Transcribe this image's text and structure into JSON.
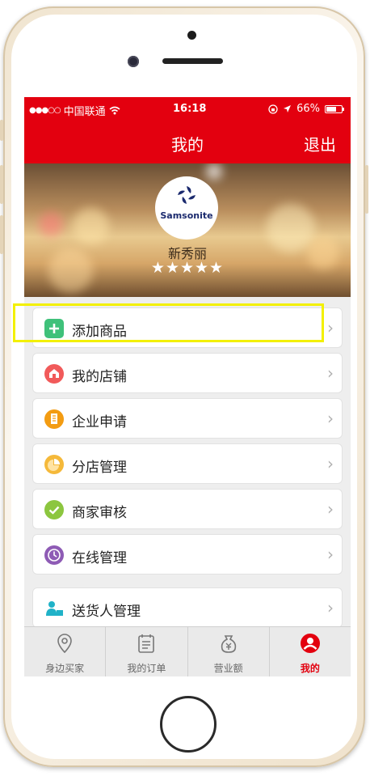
{
  "status_bar": {
    "carrier": "中国联通",
    "time": "16:18",
    "battery": "66%",
    "battery_level": 0.66
  },
  "header": {
    "title": "我的",
    "logout_label": "退出"
  },
  "profile": {
    "logo_text": "Samsonite",
    "store_name": "新秀丽",
    "rating_text": "★★★★★",
    "rating": 5
  },
  "menu": {
    "items": [
      {
        "label": "添加商品",
        "icon": "plus-icon",
        "color": "#3fc17a"
      },
      {
        "label": "我的店铺",
        "icon": "store-icon",
        "color": "#f15a5a"
      },
      {
        "label": "企业申请",
        "icon": "enterprise-icon",
        "color": "#f39c12"
      },
      {
        "label": "分店管理",
        "icon": "pie-chart-icon",
        "color": "#f5b93a"
      },
      {
        "label": "商家审核",
        "icon": "check-icon",
        "color": "#8cc63f"
      },
      {
        "label": "在线管理",
        "icon": "clock-icon",
        "color": "#8e5bb5"
      },
      {
        "label": "送货人管理",
        "icon": "courier-icon",
        "color": "#20b2c8"
      }
    ],
    "chevron": "›"
  },
  "tabs": [
    {
      "label": "身边买家",
      "icon": "location-pin-icon"
    },
    {
      "label": "我的订单",
      "icon": "order-list-icon"
    },
    {
      "label": "营业额",
      "icon": "money-bag-icon"
    },
    {
      "label": "我的",
      "icon": "user-icon",
      "active": true
    }
  ],
  "colors": {
    "brand_red": "#e3000f",
    "highlight_yellow": "#f3f000"
  }
}
